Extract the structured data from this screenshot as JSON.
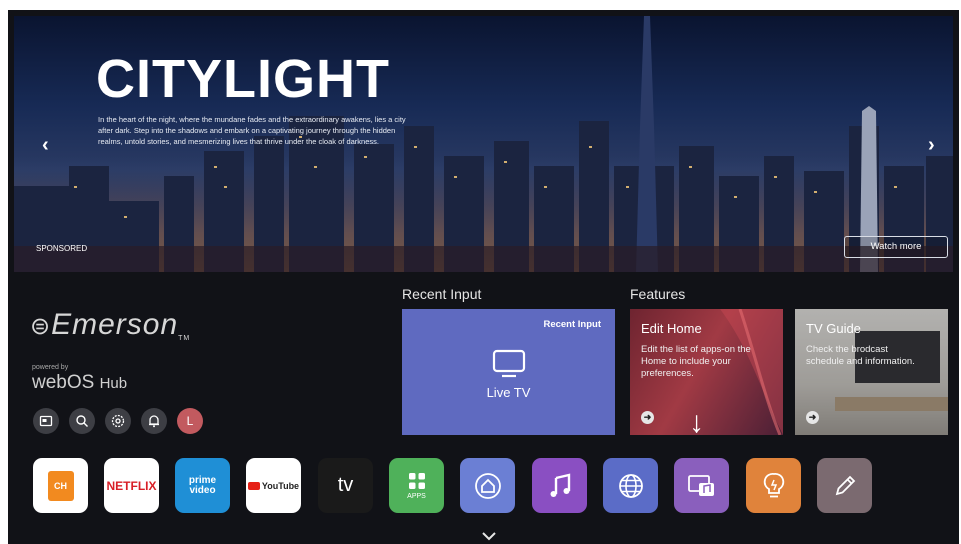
{
  "hero": {
    "title": "CITYLIGHT",
    "description": "In the heart of the night, where the mundane fades and the extraordinary awakens, lies a city after dark. Step into the shadows and embark on a captivating journey through the hidden realms, untold stories, and mesmerizing lives that thrive under the cloak of darkness.",
    "sponsored": "SPONSORED",
    "watch_more": "Watch more",
    "prev_icon": "chevron-left-icon",
    "next_icon": "chevron-right-icon"
  },
  "brand": {
    "name": "Emerson",
    "tm": "TM",
    "powered_by": "powered by",
    "webos": "webOS",
    "hub": "Hub"
  },
  "quick_icons": [
    "input-icon",
    "search-icon",
    "settings-icon",
    "notifications-icon",
    "user-avatar"
  ],
  "user_initial": "L",
  "recent_input": {
    "section_label": "Recent Input",
    "card_tag": "Recent Input",
    "card_label": "Live TV"
  },
  "features": {
    "section_label": "Features",
    "cards": [
      {
        "title": "Edit Home",
        "description": "Edit the list of apps-on the Home to include your preferences."
      },
      {
        "title": "TV Guide",
        "description": "Check the brodcast schedule and information."
      }
    ]
  },
  "apps": [
    {
      "name": "channel-plus",
      "label": "CH",
      "color": "#ffffff"
    },
    {
      "name": "netflix",
      "label": "NETFLIX",
      "color": "#ffffff"
    },
    {
      "name": "prime-video",
      "label": "prime video",
      "color": "#1f8fd6"
    },
    {
      "name": "youtube",
      "label": "YouTube",
      "color": "#ffffff"
    },
    {
      "name": "apple-tv",
      "label": "tv",
      "color": "#1a1a1a"
    },
    {
      "name": "apps",
      "label": "APPS",
      "color": "#4fb15a"
    },
    {
      "name": "home-dashboard",
      "label": "",
      "color": "#6b7fd4"
    },
    {
      "name": "music",
      "label": "",
      "color": "#8a4fc2"
    },
    {
      "name": "web-browser",
      "label": "",
      "color": "#5b6cc7"
    },
    {
      "name": "media-player",
      "label": "",
      "color": "#8a5fbd"
    },
    {
      "name": "tips",
      "label": "",
      "color": "#e0833b"
    },
    {
      "name": "edit",
      "label": "",
      "color": "#7b6a70"
    }
  ],
  "more_icon": "chevron-down-icon"
}
